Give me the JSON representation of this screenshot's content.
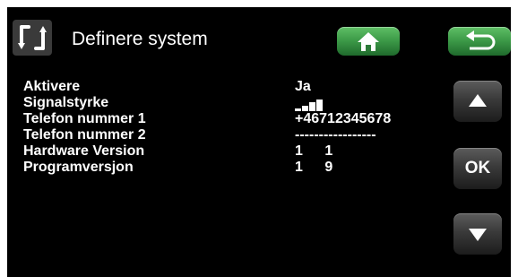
{
  "header": {
    "title": "Definere system",
    "system_icon": "refresh-arrows-icon",
    "home_icon": "home-icon",
    "back_icon": "back-arrow-icon",
    "button_color": "#3e9c49"
  },
  "rows": [
    {
      "label": "Aktivere",
      "value": "Ja"
    },
    {
      "label": "Signalstyrke",
      "value_icon": "signal-strength-icon",
      "signal_level": 4,
      "signal_max": 5
    },
    {
      "label": "Telefon nummer 1",
      "value": "+46712345678"
    },
    {
      "label": "Telefon nummer 2",
      "value": "-----------------"
    },
    {
      "label": "Hardware Version",
      "value": "1 1"
    },
    {
      "label": "Programversjon",
      "value": "1 9"
    }
  ],
  "nav": {
    "up_icon": "arrow-up-icon",
    "ok_label": "OK",
    "down_icon": "arrow-down-icon"
  }
}
